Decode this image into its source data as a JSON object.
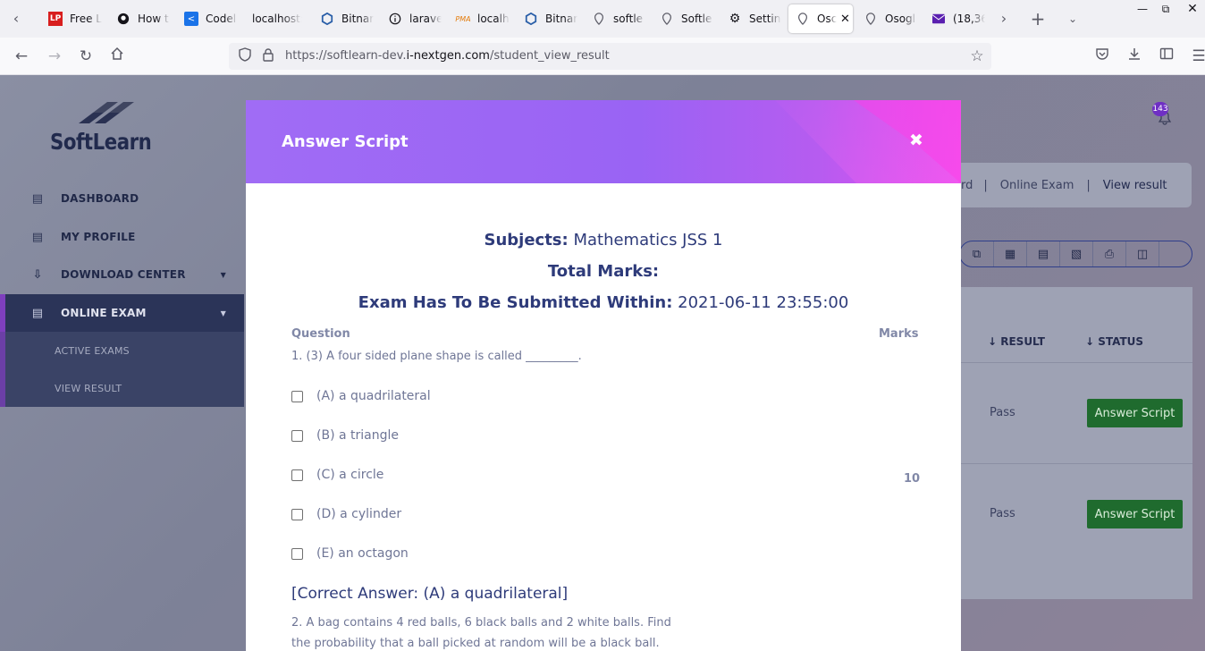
{
  "browser": {
    "tabs": [
      {
        "label": "Free L",
        "icon": "lp-icon"
      },
      {
        "label": "How t",
        "icon": "github-icon"
      },
      {
        "label": "Codel",
        "icon": "share-icon"
      },
      {
        "label": "localhost:",
        "icon": "none"
      },
      {
        "label": "Bitnar",
        "icon": "bitnami-icon"
      },
      {
        "label": "larave",
        "icon": "info-icon"
      },
      {
        "label": "localh",
        "icon": "phpmyadmin-icon"
      },
      {
        "label": "Bitnar",
        "icon": "bitnami-icon"
      },
      {
        "label": "softle",
        "icon": "pin-icon"
      },
      {
        "label": "Softle",
        "icon": "pin-icon"
      },
      {
        "label": "Settin",
        "icon": "gear-icon"
      },
      {
        "label": "Osc",
        "icon": "pin-icon"
      },
      {
        "label": "Osogl",
        "icon": "pin-icon"
      },
      {
        "label": "(18,36",
        "icon": "mail-icon"
      }
    ],
    "url_prefix": "https://softlearn-dev.",
    "url_domain": "i-nextgen.com",
    "url_path": "/student_view_result"
  },
  "app": {
    "logo_text": "SoftLearn",
    "notification_count": "143"
  },
  "sidebar": {
    "items": [
      {
        "label": "DASHBOARD",
        "icon": "dashboard-icon"
      },
      {
        "label": "MY PROFILE",
        "icon": "profile-icon"
      },
      {
        "label": "DOWNLOAD CENTER",
        "icon": "download-icon"
      },
      {
        "label": "ONLINE EXAM",
        "icon": "exam-icon"
      }
    ],
    "subitems": [
      {
        "label": "ACTIVE EXAMS"
      },
      {
        "label": "VIEW RESULT"
      }
    ]
  },
  "breadcrumb": {
    "item1": "rd",
    "sep": "|",
    "item2": "Online Exam",
    "item3": "View result"
  },
  "table": {
    "headers": [
      "RESULT",
      "STATUS"
    ],
    "rows": [
      {
        "result": "Pass",
        "action": "Answer Script"
      },
      {
        "result": "Pass",
        "action": "Answer Script"
      }
    ]
  },
  "modal": {
    "title": "Answer Script",
    "close_glyph": "✖",
    "subjects_label": "Subjects:",
    "subjects_value": "Mathematics JSS 1",
    "total_marks_label": "Total Marks:",
    "total_marks_value": "",
    "deadline_label": "Exam Has To Be Submitted Within:",
    "deadline_value": "2021-06-11 23:55:00",
    "col_question": "Question",
    "col_marks": "Marks",
    "question1": "1. (3) A four sided plane shape is called _________.",
    "options": [
      "(A) a quadrilateral",
      "(B) a triangle",
      "(C) a circle",
      "(D) a cylinder",
      "(E) an octagon"
    ],
    "marks_value": "10",
    "correct_answer": "[Correct Answer: (A) a quadrilateral]",
    "question2_line1": "2. A bag contains 4 red balls, 6 black balls and 2 white balls. Find",
    "question2_line2": "the probability that a ball picked at random will be a black ball."
  },
  "colors": {
    "header_gradient_start": "#a06cf5",
    "header_gradient_end": "#e74bef",
    "heading_text": "#2e3b7a",
    "button_green": "#1f6b2e"
  }
}
